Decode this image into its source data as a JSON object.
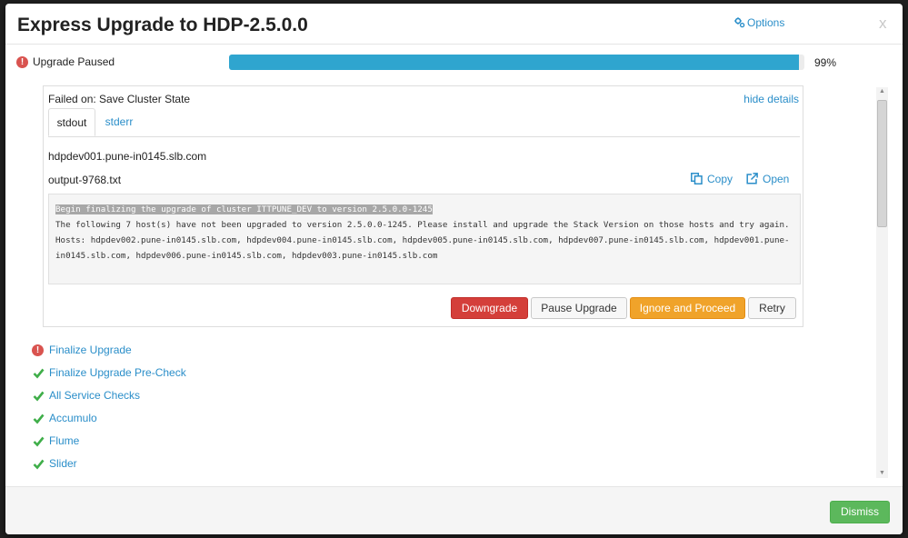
{
  "modal": {
    "title": "Express Upgrade to HDP-2.5.0.0",
    "options_label": "Options",
    "close_label": "x"
  },
  "status": {
    "text": "Upgrade Paused",
    "progress_percent": 99,
    "progress_label": "99%",
    "icon": "alert-circle-icon"
  },
  "details": {
    "failed_on": "Failed on: Save Cluster State",
    "hide_details": "hide details",
    "tabs": [
      {
        "label": "stdout",
        "active": true
      },
      {
        "label": "stderr",
        "active": false
      }
    ],
    "hostname": "hdpdev001.pune-in0145.slb.com",
    "output_file": "output-9768.txt",
    "copy_label": "Copy",
    "open_label": "Open",
    "log": {
      "highlighted_line": "Begin finalizing the upgrade of cluster ITTPUNE_DEV to version 2.5.0.0-1245",
      "line2": "The following 7 host(s) have not been upgraded to version 2.5.0.0-1245. Please install and upgrade the Stack Version on those hosts and try again.",
      "line3": "Hosts: hdpdev002.pune-in0145.slb.com, hdpdev004.pune-in0145.slb.com, hdpdev005.pune-in0145.slb.com, hdpdev007.pune-in0145.slb.com, hdpdev001.pune-in0145.slb.com, hdpdev006.pune-in0145.slb.com, hdpdev003.pune-in0145.slb.com"
    },
    "buttons": {
      "downgrade": "Downgrade",
      "pause": "Pause Upgrade",
      "ignore": "Ignore and Proceed",
      "retry": "Retry"
    }
  },
  "steps": [
    {
      "label": "Finalize Upgrade",
      "status": "failed",
      "icon": "alert-circle-icon"
    },
    {
      "label": "Finalize Upgrade Pre-Check",
      "status": "done",
      "icon": "check-icon"
    },
    {
      "label": "All Service Checks",
      "status": "done",
      "icon": "check-icon"
    },
    {
      "label": "Accumulo",
      "status": "done",
      "icon": "check-icon"
    },
    {
      "label": "Flume",
      "status": "done",
      "icon": "check-icon"
    },
    {
      "label": "Slider",
      "status": "done",
      "icon": "check-icon"
    }
  ],
  "footer": {
    "dismiss_label": "Dismiss"
  },
  "colors": {
    "link": "#2a8ec9",
    "progress": "#2fa5cf",
    "danger": "#d43f3a",
    "warning": "#f0a32a",
    "success": "#5cb85c"
  }
}
